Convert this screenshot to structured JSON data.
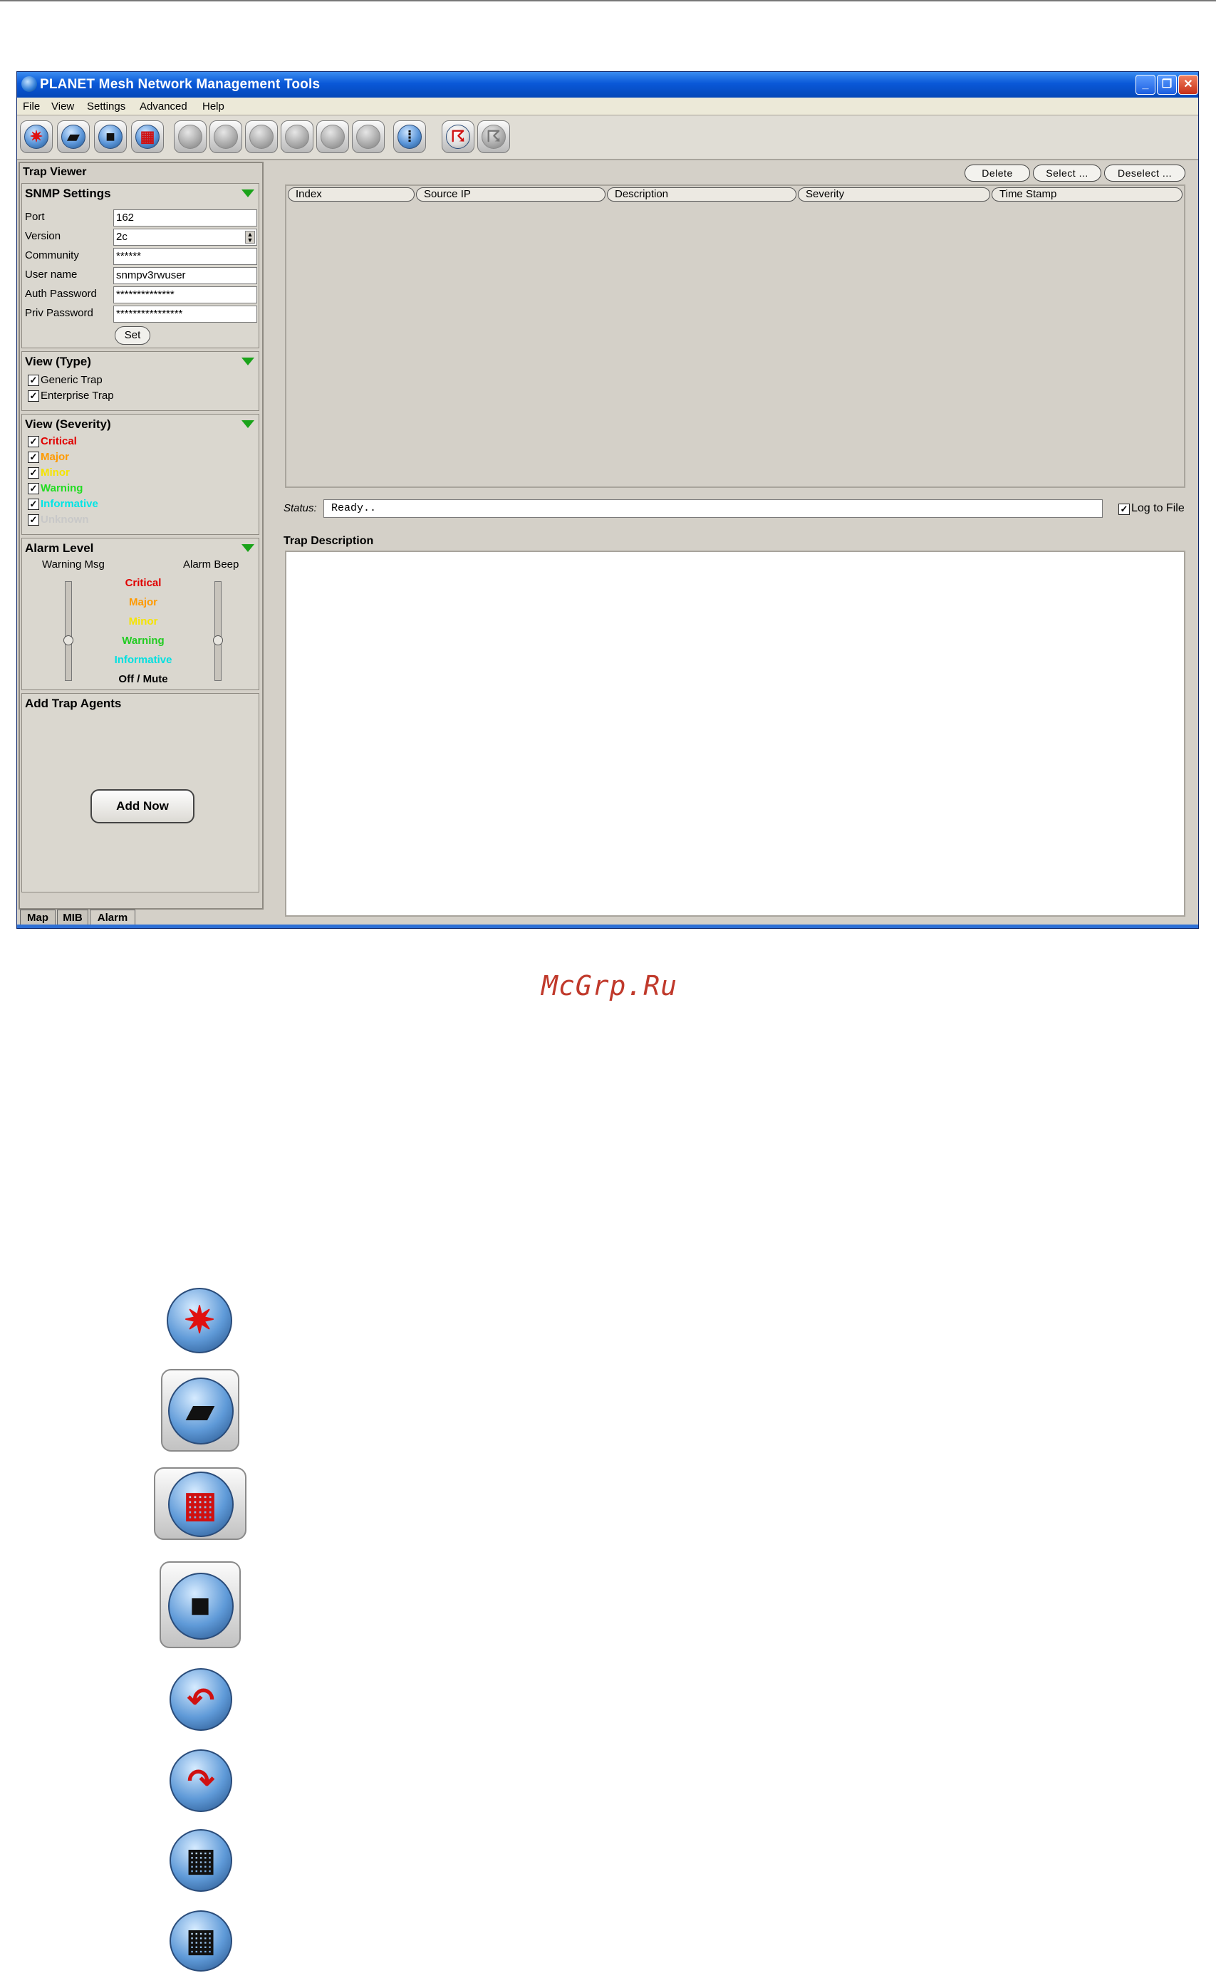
{
  "window": {
    "title": "PLANET Mesh Network Management Tools",
    "controls": {
      "minimize": "_",
      "restore": "❐",
      "close": "✕"
    }
  },
  "menu": [
    "File",
    "View",
    "Settings",
    "Advanced",
    "Help"
  ],
  "toolbar": {
    "buttons": [
      {
        "icon": "discover-icon",
        "enabled": true
      },
      {
        "icon": "open-folder-icon",
        "enabled": true
      },
      {
        "icon": "window-stack-icon",
        "enabled": true
      },
      {
        "icon": "grid-icon",
        "enabled": true
      },
      {
        "icon": "disabled-icon",
        "enabled": false
      },
      {
        "icon": "disabled-icon",
        "enabled": false
      },
      {
        "icon": "disabled-icon",
        "enabled": false
      },
      {
        "icon": "disabled-icon",
        "enabled": false
      },
      {
        "icon": "disabled-icon",
        "enabled": false
      },
      {
        "icon": "disabled-icon",
        "enabled": false
      },
      {
        "icon": "footprints-icon",
        "enabled": true
      },
      {
        "icon": "antenna-icon",
        "enabled": true
      },
      {
        "icon": "antenna-disabled-icon",
        "enabled": false
      }
    ]
  },
  "left_panel": {
    "title": "Trap Viewer",
    "snmp": {
      "header": "SNMP Settings",
      "fields": [
        {
          "label": "Port",
          "value": "162"
        },
        {
          "label": "Version",
          "value": "2c"
        },
        {
          "label": "Community",
          "value": "******"
        },
        {
          "label": "User name",
          "value": "snmpv3rwuser"
        },
        {
          "label": "Auth Password",
          "value": "**************"
        },
        {
          "label": "Priv Password",
          "value": "****************"
        }
      ],
      "set_label": "Set"
    },
    "view_type": {
      "header": "View (Type)",
      "items": [
        {
          "label": "Generic Trap",
          "checked": true
        },
        {
          "label": "Enterprise Trap",
          "checked": true
        }
      ]
    },
    "view_severity": {
      "header": "View (Severity)",
      "items": [
        {
          "label": "Critical",
          "color": "#e00000",
          "checked": true
        },
        {
          "label": "Major",
          "color": "#ff9a00",
          "checked": true
        },
        {
          "label": "Minor",
          "color": "#f5e400",
          "checked": true
        },
        {
          "label": "Warning",
          "color": "#22dd22",
          "checked": true
        },
        {
          "label": "Informative",
          "color": "#00e5e5",
          "checked": true
        },
        {
          "label": "Unknown",
          "color": "#c8c8c8",
          "checked": true
        }
      ]
    },
    "alarm_level": {
      "header": "Alarm Level",
      "warning_msg": "Warning Msg",
      "alarm_beep": "Alarm Beep",
      "levels": [
        {
          "label": "Critical",
          "color": "#e00000"
        },
        {
          "label": "Major",
          "color": "#ff9a00"
        },
        {
          "label": "Minor",
          "color": "#f5e400"
        },
        {
          "label": "Warning",
          "color": "#22cc22"
        },
        {
          "label": "Informative",
          "color": "#00e0e0"
        },
        {
          "label": "Off / Mute",
          "color": "#000000"
        }
      ],
      "warning_level_fraction": 0.4,
      "beep_level_fraction": 0.4
    },
    "add_agents": {
      "header": "Add Trap Agents",
      "button": "Add Now"
    },
    "tabs": [
      {
        "label": "Map",
        "active": false
      },
      {
        "label": "MIB",
        "active": false
      },
      {
        "label": "Alarm",
        "active": true
      }
    ]
  },
  "right_panel": {
    "buttons": [
      "Delete",
      "Select ...",
      "Deselect ..."
    ],
    "columns": [
      "Index",
      "Source IP",
      "Description",
      "Severity",
      "Time Stamp"
    ],
    "status_label": "Status:",
    "status_text": "Ready..",
    "log_to_file": {
      "label": "Log to File",
      "checked": true
    },
    "trap_description_label": "Trap Description"
  },
  "watermark": "McGrp.Ru",
  "legend_icons": [
    "discover-icon",
    "open-folder-icon",
    "grid-icon",
    "window-stack-icon",
    "rotate-left-icon",
    "rotate-right-icon",
    "table-play-icon",
    "table-refresh-icon"
  ],
  "colors": {
    "title_bar": "#0a58d8",
    "accent_blue": "#2c6fd6"
  }
}
